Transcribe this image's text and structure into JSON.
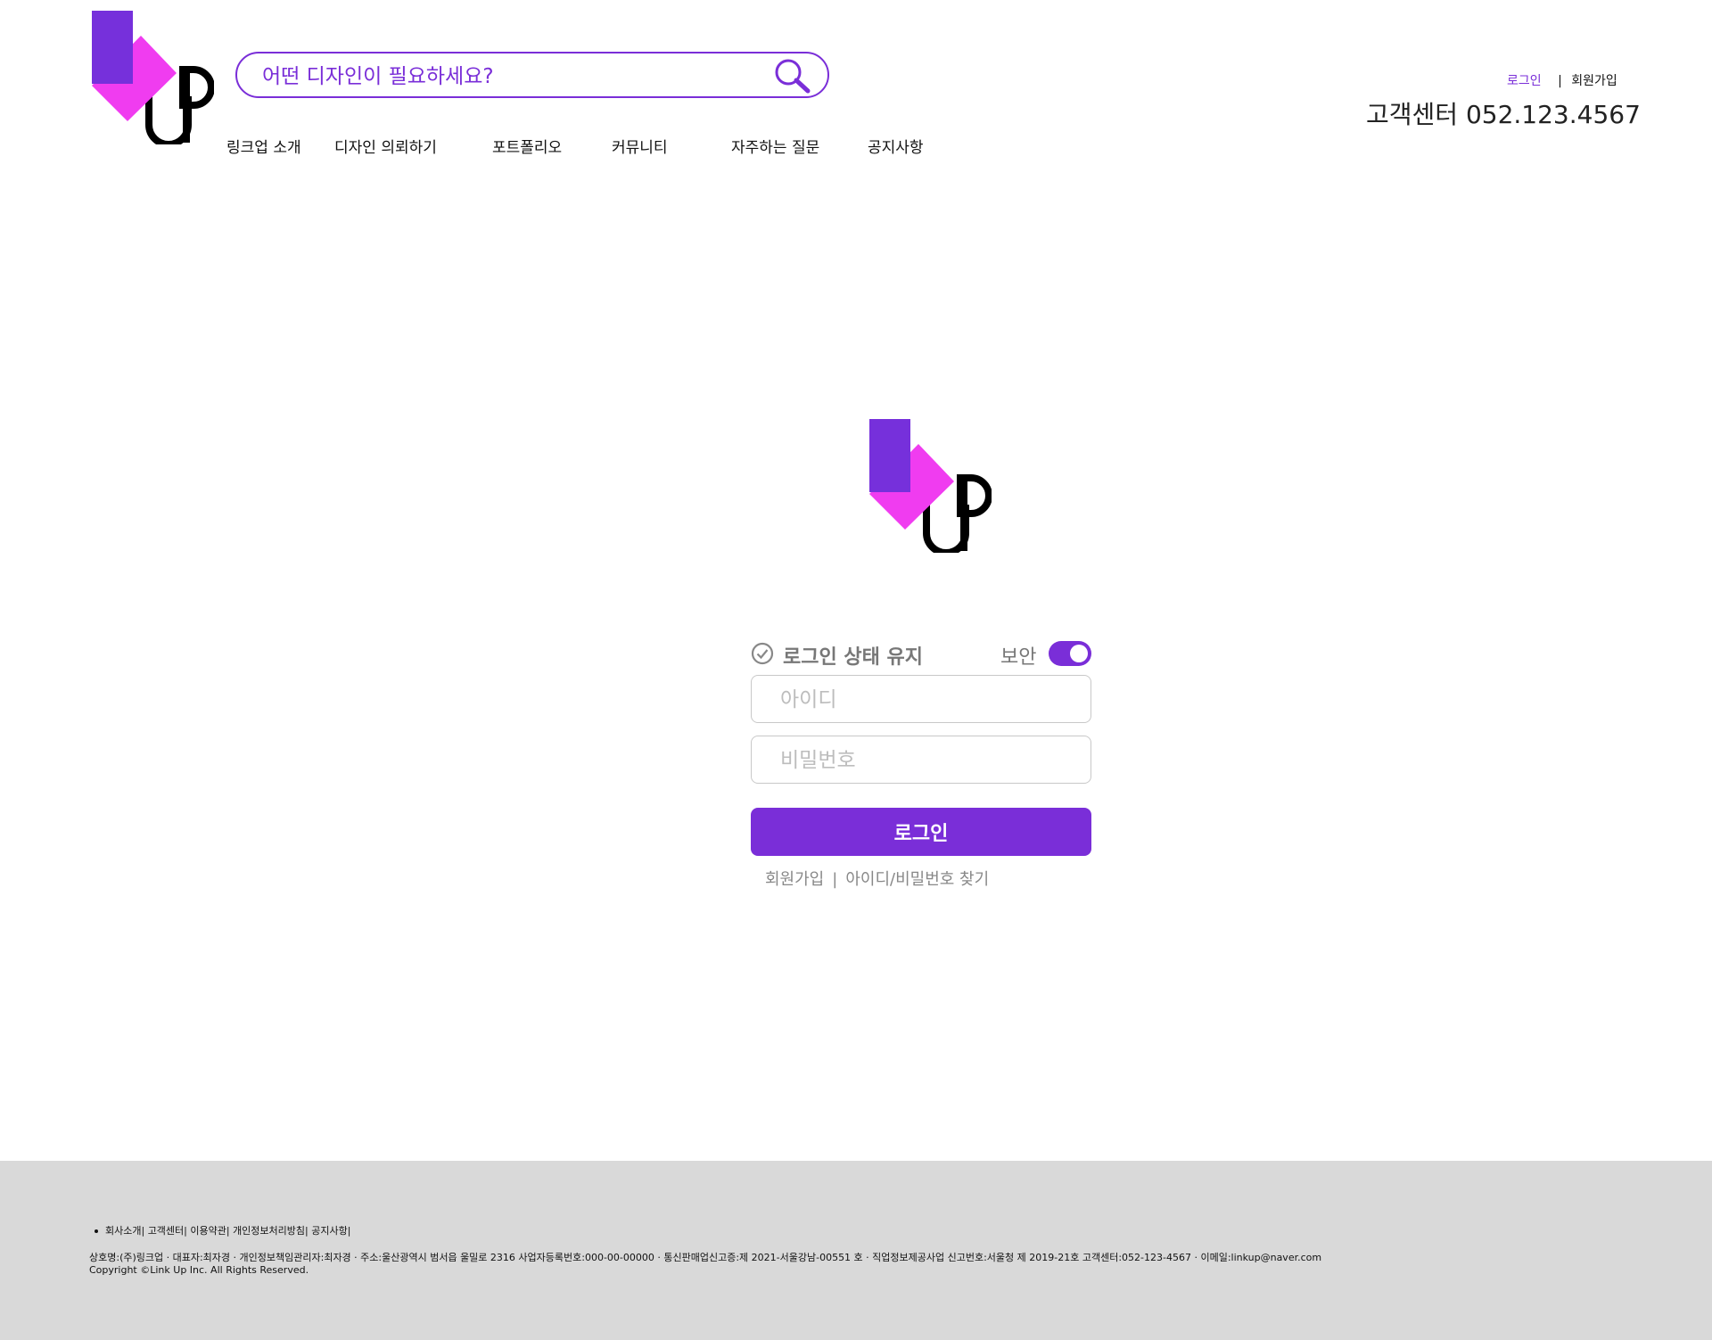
{
  "header": {
    "search": {
      "placeholder": "어떤 디자인이 필요하세요?"
    },
    "nav": [
      {
        "label": "링크업 소개"
      },
      {
        "label": "디자인 의뢰하기"
      },
      {
        "label": "포트폴리오"
      },
      {
        "label": "커뮤니티"
      },
      {
        "label": "자주하는 질문"
      },
      {
        "label": "공지사항"
      }
    ],
    "top_links": {
      "login": "로그인",
      "separator": "|",
      "signup": "회원가입"
    },
    "customer_center": "고객센터 052.123.4567"
  },
  "login_form": {
    "keep_login_label": "로그인 상태 유지",
    "security_label": "보안",
    "security_toggle_on": true,
    "id_placeholder": "아이디",
    "password_placeholder": "비밀번호",
    "login_button": "로그인",
    "signup_link": "회원가입",
    "separator": "|",
    "find_link": "아이디/비밀번호 찾기"
  },
  "footer": {
    "links": [
      "회사소개|",
      "고객센터|",
      "이용약관|",
      "개인정보처리방침|",
      "공지사항|"
    ],
    "info": "상호명:(주)링크업 · 대표자:최자경 · 개인정보책임관리자:최자경 · 주소:울산광역시 범서읍 울밀로 2316 사업자등록번호:000-00-00000 · 통신판매업신고증:제 2021-서울강남-00551 호 · 직업정보제공사업 신고번호:서울청 제 2019-21호 고객센터:052-123-4567 · 이메일:linkup@naver.com",
    "copyright": "Copyright ©Link Up Inc. All Rights Reserved."
  },
  "colors": {
    "accent": "#7a2ed8",
    "logo_purple": "#7630db",
    "logo_magenta": "#f03cf0",
    "footer_bg": "#d9d9d9"
  },
  "icons": {
    "search": "search-icon",
    "keep_login": "check-circle-icon",
    "toggle": "toggle-switch"
  }
}
